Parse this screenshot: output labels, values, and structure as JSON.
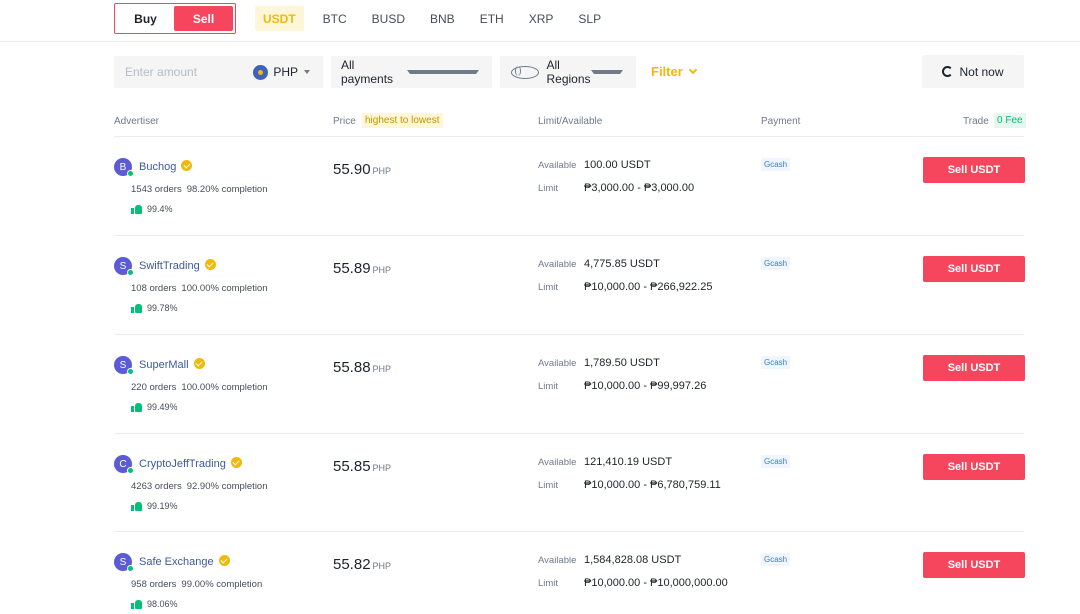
{
  "toggle": {
    "buy_label": "Buy",
    "sell_label": "Sell"
  },
  "coins": [
    "USDT",
    "BTC",
    "BUSD",
    "BNB",
    "ETH",
    "XRP",
    "SLP"
  ],
  "filters": {
    "amount_placeholder": "Enter amount",
    "currency": "PHP",
    "payment": "All payments",
    "region": "All Regions",
    "filter_label": "Filter",
    "not_now_label": "Not now"
  },
  "table_header": {
    "advertiser": "Advertiser",
    "price": "Price",
    "price_sort": "highest to lowest",
    "limit_available": "Limit/Available",
    "payment": "Payment",
    "trade": "Trade",
    "fee": "0 Fee"
  },
  "rows": [
    {
      "initial": "B",
      "name": "Buchog",
      "orders": "1543 orders",
      "completion": "98.20% completion",
      "rating": "99.4%",
      "price": "55.90",
      "currency": "PHP",
      "available_label": "Available",
      "available": "100.00 USDT",
      "limit_label": "Limit",
      "limit": "₱3,000.00 - ₱3,000.00",
      "payment": "Gcash",
      "button": "Sell USDT"
    },
    {
      "initial": "S",
      "name": "SwiftTrading",
      "orders": "108 orders",
      "completion": "100.00% completion",
      "rating": "99.78%",
      "price": "55.89",
      "currency": "PHP",
      "available_label": "Available",
      "available": "4,775.85 USDT",
      "limit_label": "Limit",
      "limit": "₱10,000.00 - ₱266,922.25",
      "payment": "Gcash",
      "button": "Sell USDT"
    },
    {
      "initial": "S",
      "name": "SuperMall",
      "orders": "220 orders",
      "completion": "100.00% completion",
      "rating": "99.49%",
      "price": "55.88",
      "currency": "PHP",
      "available_label": "Available",
      "available": "1,789.50 USDT",
      "limit_label": "Limit",
      "limit": "₱10,000.00 - ₱99,997.26",
      "payment": "Gcash",
      "button": "Sell USDT"
    },
    {
      "initial": "C",
      "name": "CryptoJeffTrading",
      "orders": "4263 orders",
      "completion": "92.90% completion",
      "rating": "99.19%",
      "price": "55.85",
      "currency": "PHP",
      "available_label": "Available",
      "available": "121,410.19 USDT",
      "limit_label": "Limit",
      "limit": "₱10,000.00 - ₱6,780,759.11",
      "payment": "Gcash",
      "button": "Sell USDT"
    },
    {
      "initial": "S",
      "name": "Safe Exchange",
      "orders": "958 orders",
      "completion": "99.00% completion",
      "rating": "98.06%",
      "price": "55.82",
      "currency": "PHP",
      "available_label": "Available",
      "available": "1,584,828.08 USDT",
      "limit_label": "Limit",
      "limit": "₱10,000.00 - ₱10,000,000.00",
      "payment": "Gcash",
      "button": "Sell USDT"
    }
  ],
  "colors": {
    "sell": "#f6465d",
    "accent": "#f0b90b",
    "online": "#02c076"
  }
}
